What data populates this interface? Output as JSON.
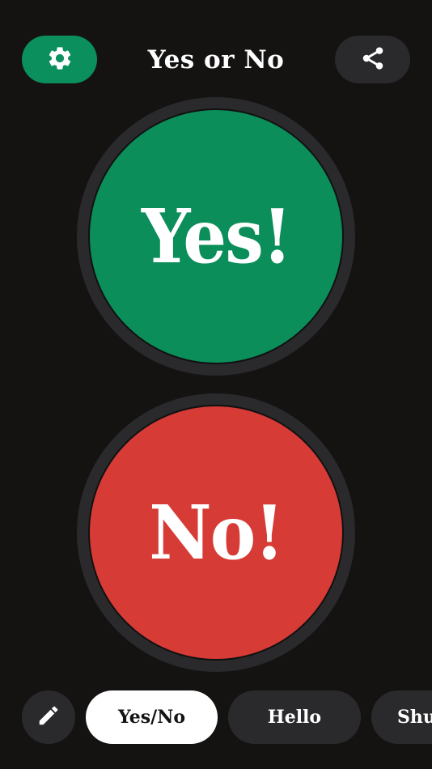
{
  "header": {
    "title": "Yes or No",
    "settings_icon": "gear-icon",
    "share_icon": "share-icon"
  },
  "buttons": {
    "yes_label": "Yes!",
    "no_label": "No!"
  },
  "bottom_bar": {
    "edit_icon": "pencil-icon",
    "tabs": [
      {
        "label": "Yes/No",
        "selected": true
      },
      {
        "label": "Hello",
        "selected": false
      },
      {
        "label": "Shu",
        "selected": false
      }
    ]
  },
  "colors": {
    "background": "#151212",
    "accent_green": "#0b8e5a",
    "accent_red": "#d63b36",
    "surface": "#2a2a2c"
  }
}
